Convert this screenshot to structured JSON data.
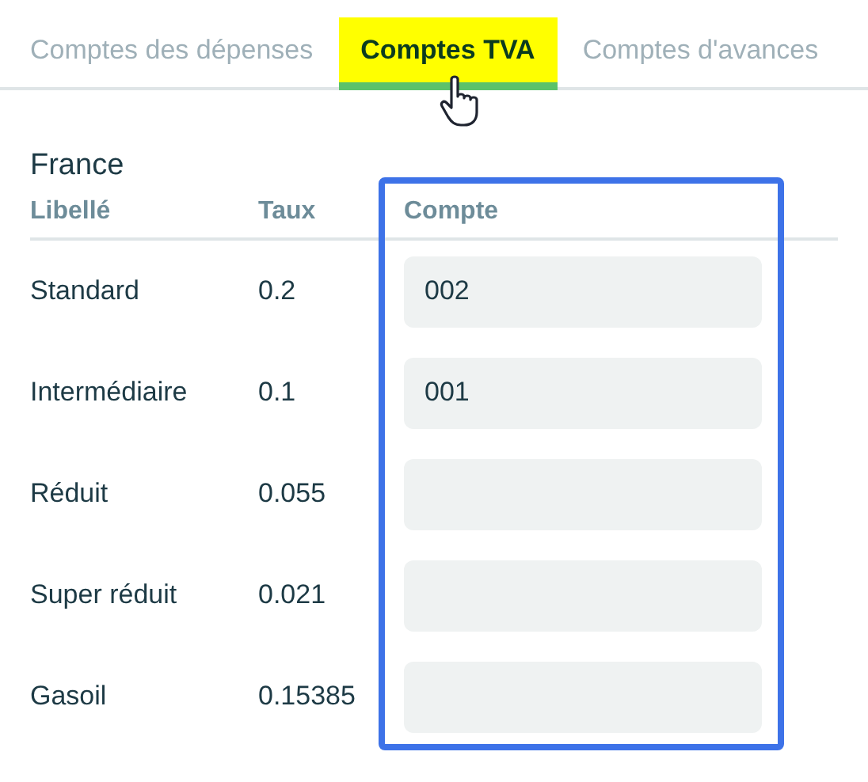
{
  "tabs": [
    {
      "label": "Comptes des dépenses",
      "selected": false
    },
    {
      "label": "Comptes TVA",
      "selected": true
    },
    {
      "label": "Comptes d'avances",
      "selected": false
    }
  ],
  "section": {
    "title": "France"
  },
  "table": {
    "columns": [
      "Libellé",
      "Taux",
      "Compte"
    ],
    "rows": [
      {
        "label": "Standard",
        "rate": "0.2",
        "account": "002"
      },
      {
        "label": "Intermédiaire",
        "rate": "0.1",
        "account": "001"
      },
      {
        "label": "Réduit",
        "rate": "0.055"
      },
      {
        "label": "Super réduit",
        "rate": "0.021"
      },
      {
        "label": "Gasoil",
        "rate": "0.15385"
      }
    ]
  }
}
